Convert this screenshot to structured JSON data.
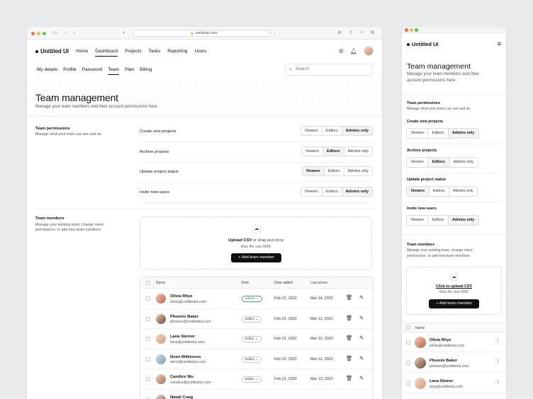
{
  "browser": {
    "url": "untitledui.com"
  },
  "brand": "Untitled UI",
  "nav": {
    "items": [
      "Home",
      "Dashboard",
      "Projects",
      "Tasks",
      "Reporting",
      "Users"
    ],
    "active": "Dashboard"
  },
  "tabs": {
    "items": [
      "My details",
      "Profile",
      "Password",
      "Team",
      "Plan",
      "Billing"
    ],
    "active": "Team"
  },
  "search": {
    "placeholder": "Search"
  },
  "page": {
    "title": "Team management",
    "subtitle": "Manage your team members and their account permissions here."
  },
  "permissions": {
    "title": "Team permissions",
    "description": "Manage what your team can see and do.",
    "options": [
      "Viewers",
      "Editors",
      "Admins only"
    ],
    "rows": [
      {
        "label": "Create new projects",
        "selected": "Admins only"
      },
      {
        "label": "Archive projects",
        "selected": "Editors"
      },
      {
        "label": "Update project status",
        "selected": "Viewers"
      },
      {
        "label": "Invite new users",
        "selected": "Admins only"
      }
    ]
  },
  "members": {
    "title": "Team members",
    "description": "Manage your existing team, change roles/ permissions, or add new team members.",
    "upload": {
      "strong": "Upload CSV",
      "rest": " or drag and drop",
      "size": "Max file size 6MB",
      "mobile_link": "Click to upload CSV",
      "button": "Add team member"
    },
    "columns": {
      "name": "Name",
      "role": "Role",
      "date_added": "Date added",
      "last_active": "Last active"
    },
    "rows": [
      {
        "name": "Olivia Rhye",
        "email": "olivia@untitledui.com",
        "role": "Admin",
        "date_added": "Feb 22, 2022",
        "last_active": "Mar 14, 2022"
      },
      {
        "name": "Phoenix Baker",
        "email": "phoenix@untitledui.com",
        "role": "Editor",
        "date_added": "Feb 22, 2022",
        "last_active": "Mar 12, 2022"
      },
      {
        "name": "Lana Steiner",
        "email": "lana@untitledui.com",
        "role": "Editor",
        "date_added": "Feb 22, 2022",
        "last_active": "Mar 12, 2022"
      },
      {
        "name": "Demi Wilkinson",
        "email": "demi@untitledui.com",
        "role": "Editor",
        "date_added": "Feb 22, 2022",
        "last_active": "Mar 12, 2022"
      },
      {
        "name": "Candice Wu",
        "email": "candice@untitledui.com",
        "role": "Editor",
        "date_added": "Feb 22, 2022",
        "last_active": "Mar 13, 2022"
      },
      {
        "name": "Natali Craig",
        "email": "",
        "role": "",
        "date_added": "",
        "last_active": ""
      }
    ]
  },
  "colors": {
    "admin_badge": "#2a7a44",
    "dark_button": "#111111"
  }
}
